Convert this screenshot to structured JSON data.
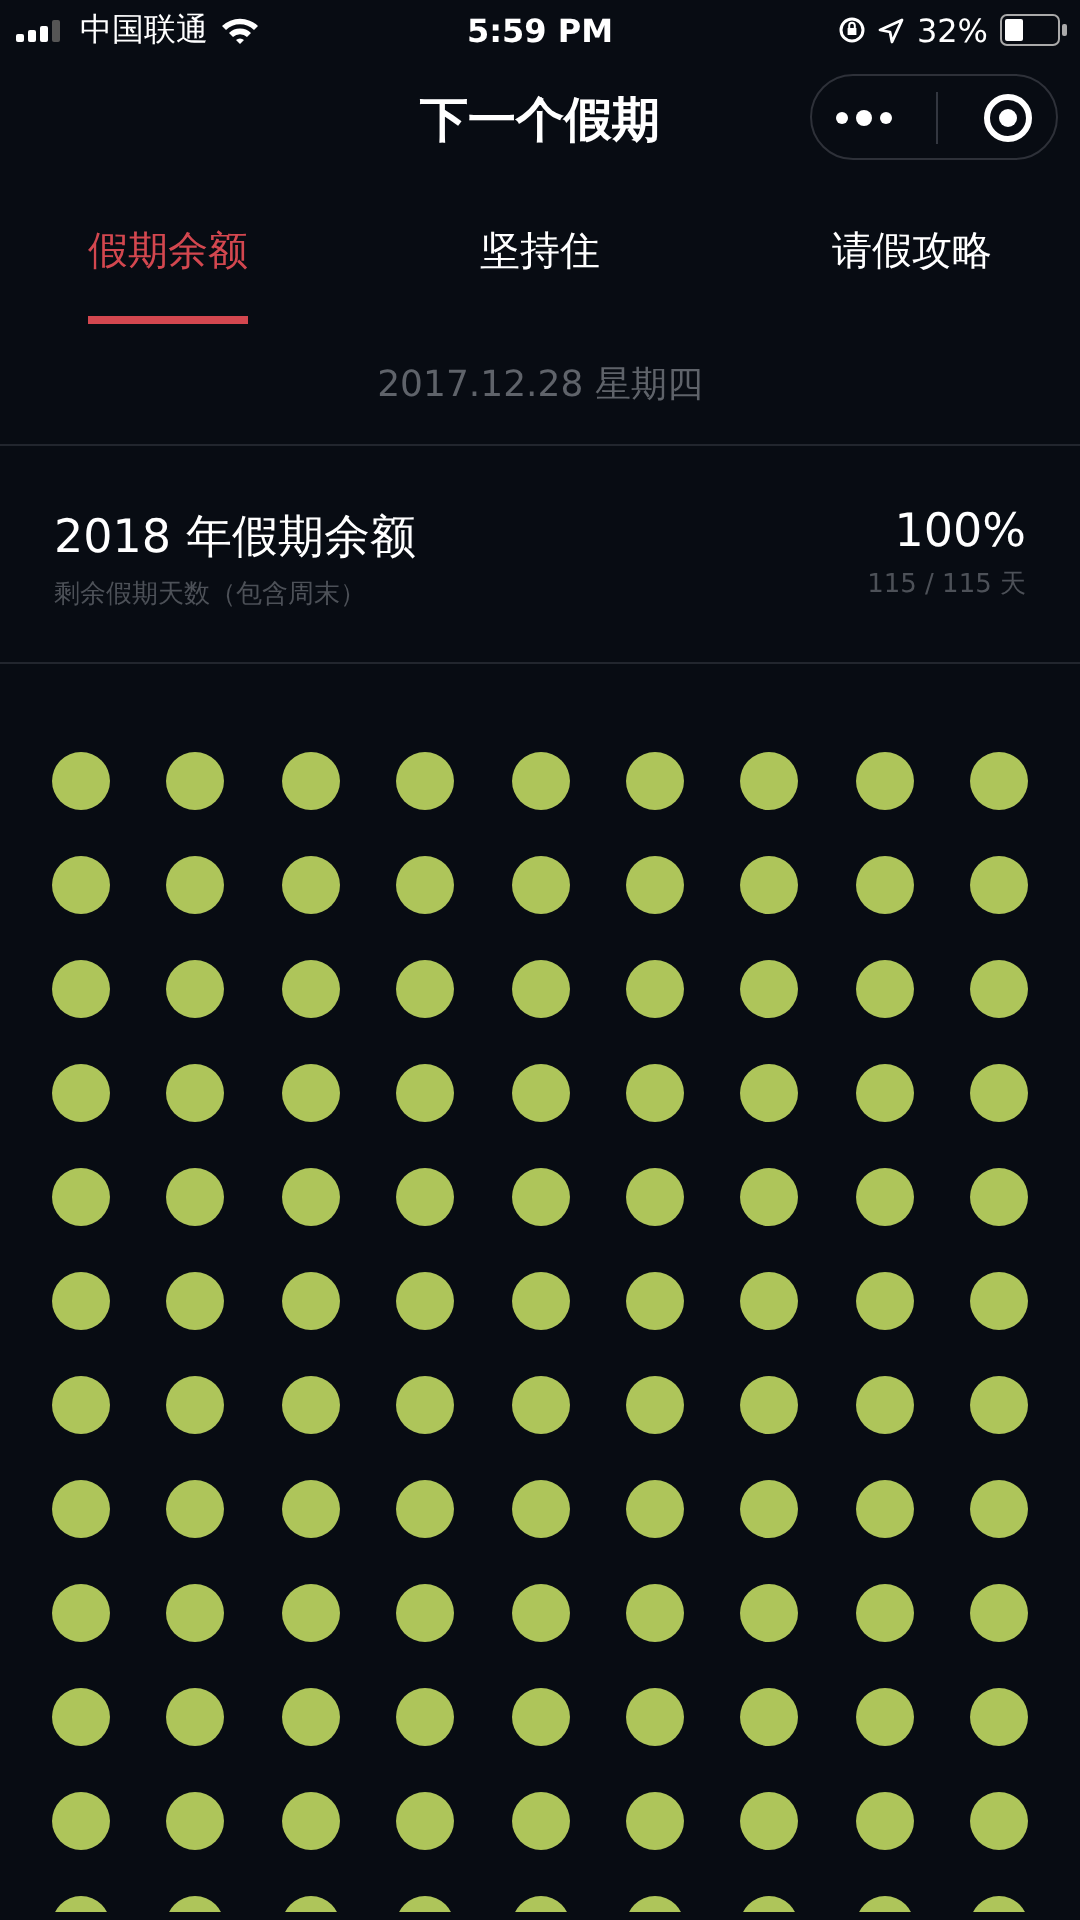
{
  "status_bar": {
    "carrier": "中国联通",
    "time": "5:59 PM",
    "battery": "32%"
  },
  "nav": {
    "title": "下一个假期"
  },
  "tabs": [
    {
      "label": "假期余额",
      "selected": true
    },
    {
      "label": "坚持住",
      "selected": false
    },
    {
      "label": "请假攻略",
      "selected": false
    }
  ],
  "date": "2017.12.28 星期四",
  "summary": {
    "title": "2018 年假期余额",
    "subtitle": "剩余假期天数（包含周末）",
    "percent": "100%",
    "count": "115 / 115 天"
  },
  "dots": [
    {
      "filled": true
    },
    {
      "filled": true
    },
    {
      "filled": true
    },
    {
      "filled": true
    },
    {
      "filled": true
    },
    {
      "filled": true
    },
    {
      "filled": true
    },
    {
      "filled": true
    },
    {
      "filled": true
    },
    {
      "filled": true
    },
    {
      "filled": true
    },
    {
      "filled": true
    },
    {
      "filled": true
    },
    {
      "filled": true
    },
    {
      "filled": true
    },
    {
      "filled": true
    },
    {
      "filled": true
    },
    {
      "filled": true
    },
    {
      "filled": true
    },
    {
      "filled": true
    },
    {
      "filled": true
    },
    {
      "filled": true
    },
    {
      "filled": true
    },
    {
      "filled": true
    },
    {
      "filled": true
    },
    {
      "filled": true
    },
    {
      "filled": true
    },
    {
      "filled": true
    },
    {
      "filled": true
    },
    {
      "filled": true
    },
    {
      "filled": true
    },
    {
      "filled": true
    },
    {
      "filled": true
    },
    {
      "filled": true
    },
    {
      "filled": true
    },
    {
      "filled": true
    },
    {
      "filled": true
    },
    {
      "filled": true
    },
    {
      "filled": true
    },
    {
      "filled": true
    },
    {
      "filled": true
    },
    {
      "filled": true
    },
    {
      "filled": true
    },
    {
      "filled": true
    },
    {
      "filled": true
    },
    {
      "filled": true
    },
    {
      "filled": true
    },
    {
      "filled": true
    },
    {
      "filled": true
    },
    {
      "filled": true
    },
    {
      "filled": true
    },
    {
      "filled": true
    },
    {
      "filled": true
    },
    {
      "filled": true
    },
    {
      "filled": true
    },
    {
      "filled": true
    },
    {
      "filled": true
    },
    {
      "filled": true
    },
    {
      "filled": true
    },
    {
      "filled": true
    },
    {
      "filled": true
    },
    {
      "filled": true
    },
    {
      "filled": true
    },
    {
      "filled": true
    },
    {
      "filled": true
    },
    {
      "filled": true
    },
    {
      "filled": true
    },
    {
      "filled": true
    },
    {
      "filled": true
    },
    {
      "filled": true
    },
    {
      "filled": true
    },
    {
      "filled": true
    },
    {
      "filled": true
    },
    {
      "filled": true
    },
    {
      "filled": true
    },
    {
      "filled": true
    },
    {
      "filled": true
    },
    {
      "filled": true
    },
    {
      "filled": true
    },
    {
      "filled": true
    },
    {
      "filled": true
    },
    {
      "filled": true
    },
    {
      "filled": true
    },
    {
      "filled": true
    },
    {
      "filled": true
    },
    {
      "filled": true
    },
    {
      "filled": true
    },
    {
      "filled": true
    },
    {
      "filled": true
    },
    {
      "filled": true
    },
    {
      "filled": true
    },
    {
      "filled": true
    },
    {
      "filled": true
    },
    {
      "filled": true
    },
    {
      "filled": true
    },
    {
      "filled": true
    },
    {
      "filled": true
    },
    {
      "filled": true
    },
    {
      "filled": true
    },
    {
      "filled": true
    },
    {
      "filled": true
    },
    {
      "filled": true
    },
    {
      "filled": true
    },
    {
      "filled": true
    },
    {
      "filled": true
    },
    {
      "filled": true
    },
    {
      "filled": true
    },
    {
      "filled": true
    }
  ]
}
